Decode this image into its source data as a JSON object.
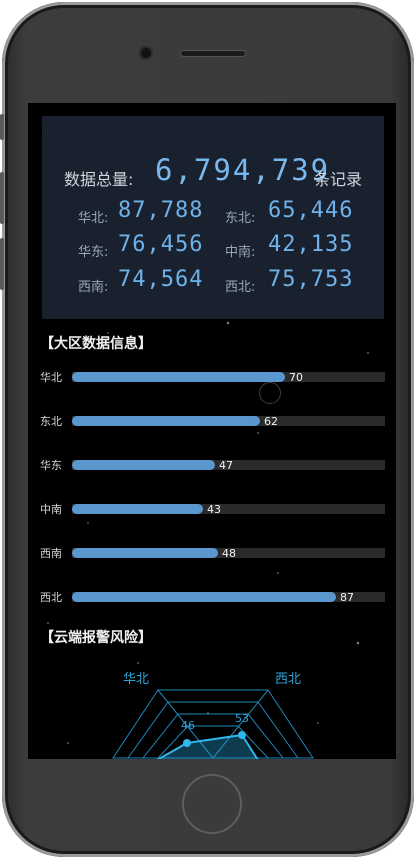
{
  "summary": {
    "total_label": "数据总量:",
    "total_value": "6,794,739",
    "total_unit": "条记录",
    "regions": [
      {
        "name": "华北:",
        "value": "87,788"
      },
      {
        "name": "东北:",
        "value": "65,446"
      },
      {
        "name": "华东:",
        "value": "76,456"
      },
      {
        "name": "中南:",
        "value": "42,135"
      },
      {
        "name": "西南:",
        "value": "74,564"
      },
      {
        "name": "西北:",
        "value": "75,753"
      }
    ]
  },
  "regional_section": {
    "title": "【大区数据信息】",
    "bars": [
      {
        "label": "华北",
        "value": 70
      },
      {
        "label": "东北",
        "value": 62
      },
      {
        "label": "华东",
        "value": 47
      },
      {
        "label": "中南",
        "value": 43
      },
      {
        "label": "西南",
        "value": 48
      },
      {
        "label": "西北",
        "value": 87
      }
    ],
    "bar_max": 100,
    "bar_color": "#5b97cf"
  },
  "alarm_section": {
    "title": "【云端报警风险】",
    "radar_labels": [
      "华北",
      "西北"
    ],
    "radar_values": [
      "46",
      "53"
    ],
    "accent": "#2fa3d8"
  }
}
